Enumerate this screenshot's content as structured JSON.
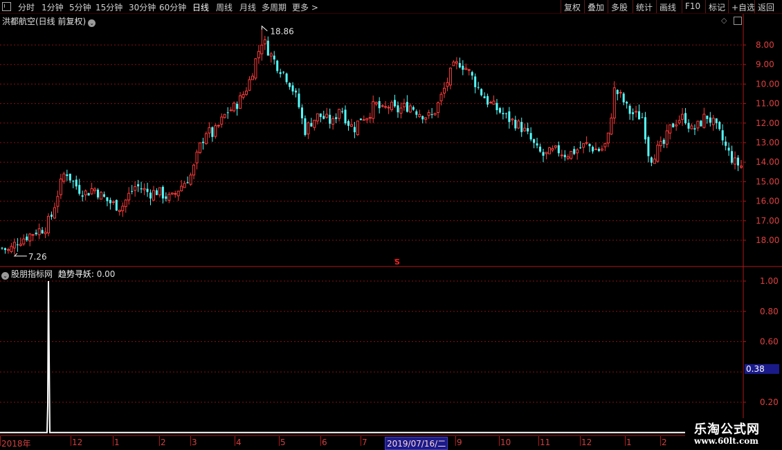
{
  "toolbar": {
    "left_items": [
      "分时",
      "1分钟",
      "5分钟",
      "15分钟",
      "30分钟",
      "60分钟",
      "日线",
      "周线",
      "月线",
      "多周期",
      "更多 >"
    ],
    "active": "日线",
    "right_items": [
      "复权",
      "叠加",
      "多股",
      "统计",
      "画线",
      "F10",
      "标记",
      "+自选",
      "返回"
    ]
  },
  "main_panel": {
    "title": "洪都航空(日线 前复权)",
    "y_ticks": [
      "18.00",
      "17.00",
      "16.00",
      "15.00",
      "14.00",
      "13.00",
      "12.00",
      "11.00",
      "10.00",
      "9.00",
      "8.00"
    ],
    "high_label": "18.86",
    "low_label": "7.26",
    "marker": "S"
  },
  "indicator_panel": {
    "title": "股朋指标网",
    "indicator_name": "趋势寻妖:",
    "indicator_value": "0.00",
    "y_ticks": [
      "1.00",
      "0.80",
      "0.60",
      "0.20"
    ],
    "cursor_value": "0.38"
  },
  "x_axis": {
    "labels": [
      "2018年",
      "12",
      "1",
      "2",
      "3",
      "4",
      "5",
      "6",
      "7",
      "2019/07/16/二",
      "9",
      "10",
      "11",
      "12",
      "1",
      "2"
    ],
    "highlight": "2019/07/16/二"
  },
  "watermark": {
    "title": "乐淘公式网",
    "url": "www.60lt.com"
  },
  "colors": {
    "up": "#ff3c3c",
    "down": "#54ffff",
    "grid": "#8a1010",
    "axis": "#b01818",
    "indicator_line": "#ffffff"
  },
  "chart_data": [
    {
      "type": "candlestick",
      "title": "洪都航空(日线 前复权)",
      "ylim": [
        7.0,
        19.0
      ],
      "y_ticks": [
        8,
        9,
        10,
        11,
        12,
        13,
        14,
        15,
        16,
        17,
        18
      ],
      "high": 18.86,
      "low": 7.26,
      "x_labels": [
        "2018年",
        "12",
        "1",
        "2",
        "3",
        "4",
        "5",
        "6",
        "7",
        "2019/07/16/二",
        "9",
        "10",
        "11",
        "12",
        "1",
        "2"
      ],
      "close_path": [
        7.6,
        7.45,
        7.9,
        8.1,
        8.3,
        8.5,
        8.6,
        9.2,
        10.5,
        11.6,
        11.0,
        10.6,
        10.4,
        10.7,
        10.3,
        10.0,
        9.8,
        9.7,
        10.3,
        10.8,
        10.6,
        10.4,
        10.5,
        10.3,
        10.1,
        10.6,
        11.0,
        11.4,
        12.7,
        13.6,
        13.4,
        14.0,
        14.6,
        14.8,
        15.3,
        16.0,
        17.2,
        18.3,
        17.6,
        17.0,
        16.6,
        16.0,
        15.1,
        13.6,
        14.1,
        14.4,
        14.2,
        14.0,
        14.9,
        14.1,
        13.7,
        14.3,
        14.4,
        15.0,
        14.6,
        14.9,
        14.6,
        14.8,
        14.9,
        14.6,
        14.4,
        14.3,
        15.0,
        15.9,
        16.8,
        17.1,
        16.8,
        16.2,
        15.6,
        15.1,
        14.8,
        14.5,
        14.2,
        14.0,
        13.7,
        13.2,
        12.6,
        12.3,
        12.5,
        12.6,
        12.4,
        12.5,
        12.7,
        12.9,
        12.7,
        12.6,
        13.0,
        15.7,
        15.3,
        14.6,
        14.4,
        14.3,
        12.1,
        12.6,
        12.9,
        13.8,
        14.2,
        14.3,
        13.6,
        13.9,
        14.4,
        14.0,
        13.4,
        12.6,
        12.0,
        11.8
      ]
    },
    {
      "type": "line",
      "name": "趋势寻妖",
      "ylim": [
        0.0,
        1.0
      ],
      "y_ticks": [
        1.0,
        0.8,
        0.6,
        0.2
      ],
      "spike_index": 8,
      "spike_value": 1.0,
      "baseline": 0.0
    }
  ]
}
